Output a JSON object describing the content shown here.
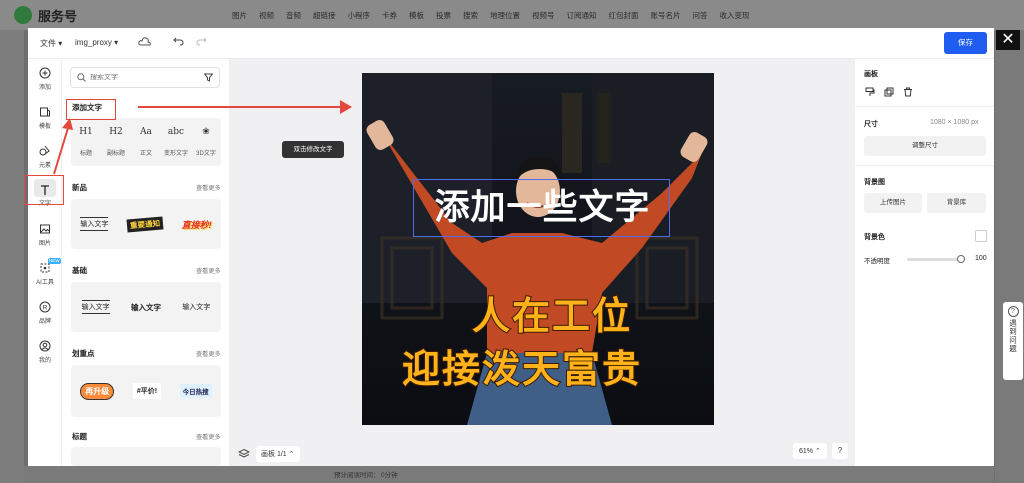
{
  "background": {
    "logo_text": "服务号",
    "nav": [
      "图片",
      "视频",
      "音频",
      "超链接",
      "小程序",
      "卡券",
      "模板",
      "投票",
      "搜索",
      "地理位置",
      "视频号",
      "订阅通知",
      "红包封面",
      "账号名片",
      "问答",
      "收入变现"
    ],
    "feedback": "遇到问题",
    "bottom_text_1": "预计阅读时间：",
    "bottom_text_2": "0分钟"
  },
  "editor": {
    "file_menu": "文件",
    "doc_name": "img_proxy",
    "save_label": "保存",
    "close": "✕"
  },
  "rail": [
    {
      "label": "添加",
      "icon": "plus-circle-icon"
    },
    {
      "label": "模板",
      "icon": "template-icon"
    },
    {
      "label": "元素",
      "icon": "shapes-icon"
    },
    {
      "label": "文字",
      "icon": "text-icon",
      "active": true
    },
    {
      "label": "图片",
      "icon": "image-icon"
    },
    {
      "label": "AI工具",
      "icon": "ai-icon",
      "tag": "NEW"
    },
    {
      "label": "品牌",
      "icon": "brand-icon"
    },
    {
      "label": "我的",
      "icon": "user-icon"
    }
  ],
  "panel": {
    "search_placeholder": "搜索文字",
    "add_text_title": "添加文字",
    "text_types": [
      {
        "glyph": "H1",
        "label": "标题"
      },
      {
        "glyph": "H2",
        "label": "副标题"
      },
      {
        "glyph": "Aa",
        "label": "正文"
      },
      {
        "glyph": "abc",
        "label": "变形文字"
      },
      {
        "glyph": "❀",
        "label": "3D文字"
      }
    ],
    "sections": [
      {
        "title": "新品",
        "more": "查看更多",
        "samples": [
          "输入文字",
          "重要通知",
          "直接秒!"
        ]
      },
      {
        "title": "基础",
        "more": "查看更多",
        "samples": [
          "输入文字",
          "输入文字",
          "输入文字"
        ]
      },
      {
        "title": "划重点",
        "more": "查看更多",
        "samples": [
          "再升级",
          "#平价!",
          "今日热搜"
        ]
      },
      {
        "title": "标题",
        "more": "查看更多",
        "samples": []
      }
    ]
  },
  "canvas": {
    "tooltip": "双击修改文字",
    "headline": "添加一些文字",
    "line1": "人在工位",
    "line2": "迎接泼天富贵",
    "page_indicator": "画板 1/1",
    "zoom": "61%",
    "help": "?"
  },
  "right_panel": {
    "artboard_title": "画板",
    "size_title": "尺寸",
    "size_value": "1080 × 1080 px",
    "resize_label": "调整尺寸",
    "bg_image_title": "背景图",
    "upload_label": "上传图片",
    "bg_library_label": "背景库",
    "bg_color_title": "背景色",
    "opacity_label": "不透明度",
    "opacity_value": "100"
  },
  "colors": {
    "accent": "#1f5cf0",
    "annotation": "#e2483d",
    "headline_fill": "#ffb21a"
  }
}
